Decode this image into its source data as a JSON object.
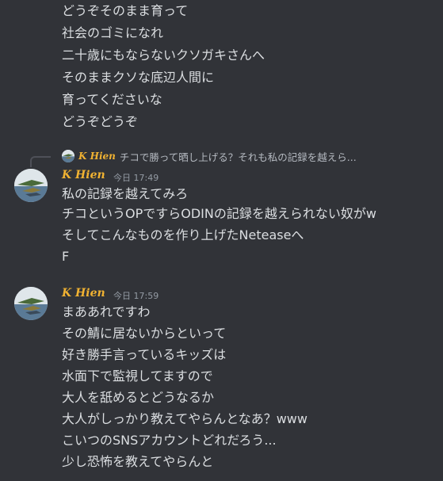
{
  "top_lines": [
    "どうぞそのまま育って",
    "社会のゴミになれ",
    "二十歳にもならないクソガキさんへ",
    "そのままクソな底辺人間に",
    "育ってくださいな",
    "どうぞどうぞ"
  ],
  "reply": {
    "author": "K Hien",
    "text": "チコで勝って晒し上げる？それも私の記録を越えら..."
  },
  "message1": {
    "author": "K Hien",
    "timestamp": "今日 17:49",
    "lines": [
      "私の記録を越えてみろ",
      "チコというOPですらODINの記録を越えられない奴がw",
      "そしてこんなものを作り上げたNeteaseへ",
      "F"
    ]
  },
  "message2": {
    "author": "K Hien",
    "timestamp": "今日 17:59",
    "lines": [
      "まああれですわ",
      "その鯖に居ないからといって",
      "好き勝手言っているキッズは",
      "水面下で監視してますので",
      "大人を舐めるとどうなるか",
      "大人がしっかり教えてやらんとなあ？www",
      "こいつのSNSアカウントどれだろう...",
      "少し恐怖を教えてやらんと"
    ]
  },
  "colors": {
    "background": "#313338",
    "text": "#dbdee1",
    "username": "#f0b232",
    "timestamp": "#949ba4"
  }
}
